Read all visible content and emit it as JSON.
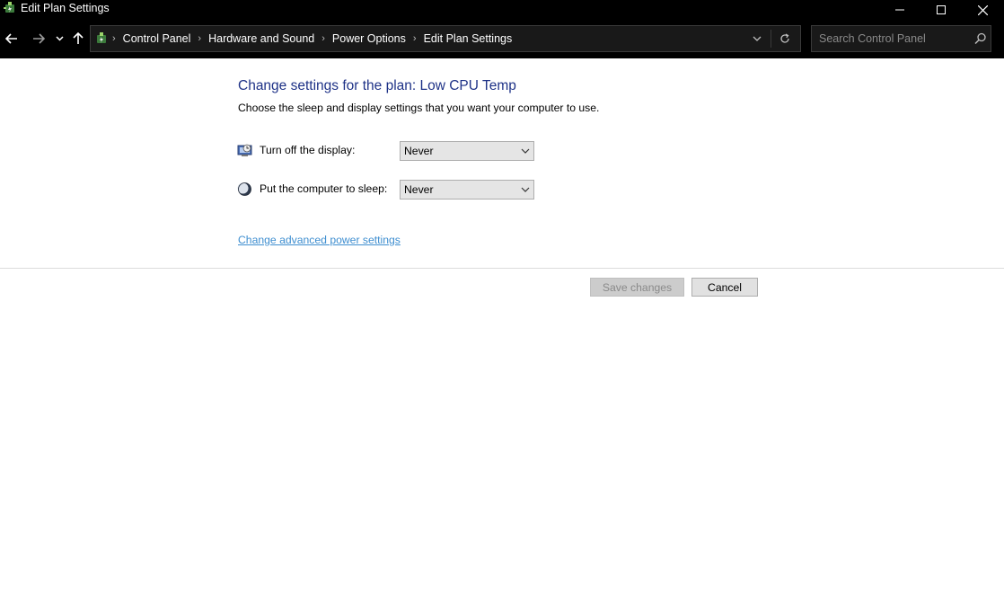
{
  "window": {
    "title": "Edit Plan Settings",
    "icon": "power-options-icon",
    "controls": [
      "minimize-icon",
      "maximize-icon",
      "close-icon"
    ]
  },
  "address": {
    "breadcrumbs": [
      {
        "label": "Control Panel"
      },
      {
        "label": "Hardware and Sound"
      },
      {
        "label": "Power Options"
      },
      {
        "label": "Edit Plan Settings"
      }
    ]
  },
  "search": {
    "placeholder": "Search Control Panel",
    "value": ""
  },
  "content": {
    "heading": "Change settings for the plan: Low CPU Temp",
    "subtext": "Choose the sleep and display settings that you want your computer to use.",
    "settings": [
      {
        "label": "Turn off the display:",
        "value": "Never",
        "icon": "display-timer-icon"
      },
      {
        "label": "Put the computer to sleep:",
        "value": "Never",
        "icon": "moon-sleep-icon"
      }
    ],
    "advanced_link": "Change advanced power settings",
    "save_label": "Save changes",
    "cancel_label": "Cancel"
  },
  "colors": {
    "heading": "#1e3287",
    "link": "#3e8ed0",
    "titlebar": "#000000"
  }
}
